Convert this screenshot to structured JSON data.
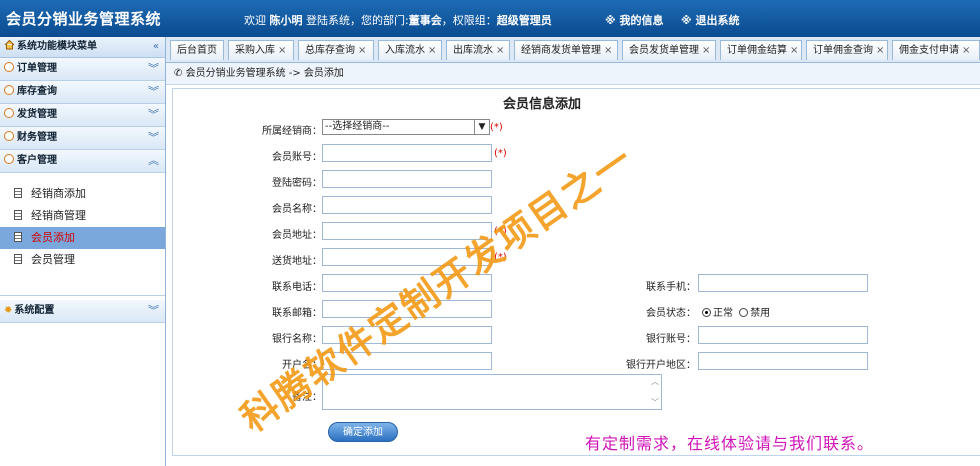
{
  "app": {
    "title": "会员分销业务管理系统"
  },
  "header": {
    "welcome_prefix": "欢迎",
    "user": "陈小明",
    "login_text": "登陆系统，您的部门:",
    "department": "董事会",
    "role_prefix": "，权限组：",
    "role": "超级管理员",
    "my_info": "※ 我的信息",
    "logout": "※ 退出系统"
  },
  "sidebar": {
    "heading": "系统功能模块菜单",
    "groups": [
      {
        "label": "订单管理"
      },
      {
        "label": "库存查询"
      },
      {
        "label": "发货管理"
      },
      {
        "label": "财务管理"
      },
      {
        "label": "客户管理"
      }
    ],
    "sub_items": [
      {
        "label": "经销商添加"
      },
      {
        "label": "经销商管理"
      },
      {
        "label": "会员添加"
      },
      {
        "label": "会员管理"
      }
    ],
    "config": "系统配置"
  },
  "tabs": [
    {
      "label": "后台首页"
    },
    {
      "label": "采购入库"
    },
    {
      "label": "总库存查询"
    },
    {
      "label": "入库流水"
    },
    {
      "label": "出库流水"
    },
    {
      "label": "经销商发货单管理"
    },
    {
      "label": "会员发货单管理"
    },
    {
      "label": "订单佣金结算"
    },
    {
      "label": "订单佣金查询"
    },
    {
      "label": "佣金支付申请"
    }
  ],
  "breadcrumb": "会员分销业务管理系统 -> 会员添加",
  "form": {
    "title": "会员信息添加",
    "required_mark": "(*)",
    "dealer_label": "所属经销商：",
    "dealer_value": "--选择经销商--",
    "account_label": "会员账号：",
    "password_label": "登陆密码：",
    "name_label": "会员名称：",
    "address_label": "会员地址：",
    "ship_label": "送货地址：",
    "phone_label": "联系电话：",
    "mobile_label": "联系手机：",
    "email_label": "联系邮箱：",
    "status_label": "会员状态：",
    "status_normal": "正常",
    "status_disabled": "禁用",
    "bank_name_label": "银行名称：",
    "bank_account_label": "银行账号：",
    "account_holder_label": "开户名：",
    "bank_region_label": "银行开户地区：",
    "remark_label": "备注：",
    "submit": "确定添加"
  },
  "watermark": "科腾软件定制开发项目之一",
  "contact": "有定制需求，在线体验请与我们联系。"
}
